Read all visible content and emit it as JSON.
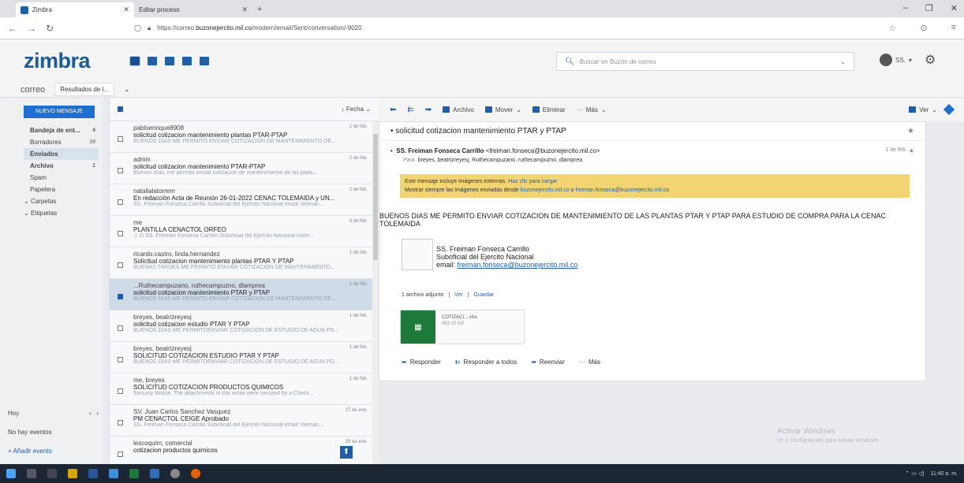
{
  "browser": {
    "tabs": [
      {
        "title": "Zimbra",
        "active": true
      },
      {
        "title": "Editar proceso",
        "active": false
      }
    ],
    "url_prefix": "https://correo.",
    "url_domain": "buzonejercito.mil.co",
    "url_path": "/modern/email/Sent/conversation/-9020"
  },
  "header": {
    "logo": "zimbra",
    "search_placeholder": "Buscar en Buzón de correo",
    "user": "SS."
  },
  "apptabs": {
    "main": "correo",
    "sub": "Resultados de l..."
  },
  "sidebar": {
    "new_message": "NUEVO MENSAJE",
    "folders": [
      {
        "label": "Bandeja de ent...",
        "count": "4",
        "bold": true,
        "selected": false
      },
      {
        "label": "Borradores",
        "count": "39",
        "bold": false,
        "selected": false
      },
      {
        "label": "Enviados",
        "count": "",
        "bold": true,
        "selected": true
      },
      {
        "label": "Archivo",
        "count": "1",
        "bold": true,
        "selected": false
      },
      {
        "label": "Spam",
        "count": "",
        "bold": false,
        "selected": false
      },
      {
        "label": "Papelera",
        "count": "",
        "bold": false,
        "selected": false
      },
      {
        "label": "Carpetas",
        "count": "",
        "bold": false,
        "selected": false,
        "tree": true
      },
      {
        "label": "Etiquetas",
        "count": "",
        "bold": false,
        "selected": false,
        "tree": true
      }
    ],
    "calendar": {
      "today": "Hoy",
      "no_events": "No hay eventos",
      "add_event": "+ Añadir evento"
    }
  },
  "list": {
    "sort_label": "Fecha",
    "rows": [
      {
        "from": "pabloenrique8908",
        "date": "2 de feb.",
        "subject": "solicitud cotizacion mantenimiento plantas PTAR-PTAP",
        "snippet": "BUENOS DIAS ME PERMITO ENVIAR COTIZACION DE MANTENIMIENTO DE...",
        "selected": false
      },
      {
        "from": "admin",
        "date": "2 de feb.",
        "subject": "solicitud cotizacion mantenimiento PTAR-PTAP",
        "snippet": "Buenos días, me permito enviar cotizacion de mantenimiento de las plata...",
        "selected": false
      },
      {
        "from": "natalialatorrem",
        "date": "2 de feb.",
        "subject": "En redacción Acta de Reunión 26-01-2022 CENAC TOLEMAIDA y UN...",
        "snippet": "SS. Freiman Fonseca Carrillo Suboficial del Ejercito Nacional email: freiman...",
        "selected": false
      },
      {
        "from": "me",
        "date": "3 de feb.",
        "subject": "PLANTILLA CENACTOL ORFEO",
        "snippet": ":) :D  SS. Freiman Fonseca Carrillo Suboficial del Ejercito Nacional corre...",
        "selected": false
      },
      {
        "from": "ricardo.castro, linda.hernandez",
        "date": "1 de feb.",
        "subject": "Solicitud cotizacion mantenimiento plantas PTAR Y PTAP",
        "snippet": "BUENAS TARDES ME PERMITO ENVIAR COTIZACION DE MANTENIMIENTO...",
        "selected": false
      },
      {
        "from": "...Ruthecampuzano, ruthecampuzno, dlamprea",
        "date": "1 de feb.",
        "subject": "solicitud cotizacion mantenimiento PTAR y PTAP",
        "snippet": "BUENOS DIAS ME PERMITO ENVIAR COTIZACION DE MANTENIMIENTO DE...",
        "selected": true
      },
      {
        "from": "breyes, beatrizreyesj",
        "date": "1 de feb.",
        "subject": "solicitud cotizacion estudio PTAR Y PTAP",
        "snippet": "BUENOS DIAS ME PERMITOENVIAR COTIZACION DE ESTUDIO DE AGUA PO...",
        "selected": false
      },
      {
        "from": "breyes, beatrizreyesj",
        "date": "1 de feb.",
        "subject": "SOLICITUD COTIZACION ESTUDIO PTAR Y PTAP",
        "snippet": "BUENOS DIAS ME PERMITOENVIAR COTIZACION DE ESTUDIO DE AGUA PO...",
        "selected": false
      },
      {
        "from": "me, breyes",
        "date": "1 de feb.",
        "subject": "SOLICITUD COTIZACION PRODUCTOS QUIMICOS",
        "snippet": "Security Notice: The attachments in this email were secured by a Check...",
        "selected": false
      },
      {
        "from": "SV. Juan Carlos Sanchez Vasquez",
        "date": "27 de ene.",
        "subject": "PM CENACTOL CEIGE Aprobado",
        "snippet": "SS. Freiman Fonseca Carrillo Suboficial del Ejercito Nacional email: freiman...",
        "selected": false
      },
      {
        "from": "lescoquim, comercial",
        "date": "29 de ene.",
        "subject": "cotizacion productos quimicos",
        "snippet": "",
        "selected": false
      }
    ]
  },
  "toolbar": {
    "archive": "Archivo",
    "move": "Mover",
    "delete": "Eliminar",
    "more": "Más",
    "view": "Ver"
  },
  "reader": {
    "subject": "solicitud cotizacion mantenimiento PTAR y PTAP",
    "sender_name": "SS. Freiman Fonseca Carrillo",
    "sender_email": "<freiman.fonseca@buzonejercito.mil.co>",
    "date": "1 de feb.",
    "to_label": "Para",
    "to": "breyes,  beatrizreyesj,  Ruthecampuzano,  ruthecampuzno,  dlamprea",
    "notice_line1": "Este mensaje incluye imágenes externas.",
    "notice_link1": "Haz clic para cargar",
    "notice_line2": "Mostrar siempre las imágenes enviadas desde",
    "notice_link2": "buzonejercito.mil.co",
    "notice_or": "o",
    "notice_link3": "freiman.fonseca@buzonejercito.mil.co",
    "body": "BUENOS DIAS ME PERMITO ENVIAR COTIZACION DE MANTENIMIENTO DE LAS PLANTAS PTAR Y PTAP PARA ESTUDIO DE COMPRA PARA LA CENAC TOLEMAIDA",
    "sig_name": "SS. Freiman Fonseca Carrillo",
    "sig_title": "Suboficial del Ejercito Nacional",
    "sig_email_label": "email:",
    "sig_email": "freiman.fonseca@buzonejercito.mil.co",
    "attach_count": "1 archivo adjunto",
    "attach_view": "Ver",
    "attach_save": "Guardar",
    "attach_name": "COTIZACI....xlsx",
    "attach_size": "453.10 KB",
    "reply": "Responder",
    "reply_all": "Responder a todos",
    "forward": "Reenviar",
    "more": "Más"
  },
  "watermark": {
    "line1": "Activar Windows",
    "line2": "Ve a Configuración para activar Windows."
  },
  "taskbar": {
    "time": "11:40 a. m."
  }
}
